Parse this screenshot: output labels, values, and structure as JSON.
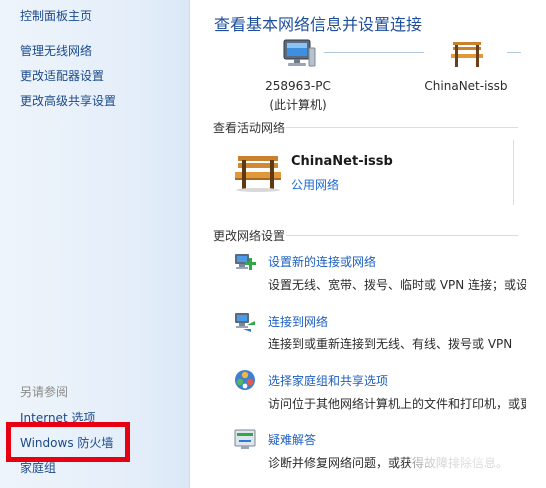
{
  "sidebar": {
    "home_link": "控制面板主页",
    "links": [
      "管理无线网络",
      "更改适配器设置",
      "更改高级共享设置"
    ],
    "see_also_header": "另请参阅",
    "see_also": [
      "Internet 选项",
      "Windows 防火墙",
      "家庭组"
    ],
    "highlight_color": "#e60012"
  },
  "main": {
    "title": "查看基本网络信息并设置连接",
    "map": {
      "computer_name": "258963-PC",
      "computer_sub": "(此计算机)",
      "network_name": "ChinaNet-issb"
    },
    "active_section": "查看活动网络",
    "active_network": {
      "name": "ChinaNet-issb",
      "type": "公用网络"
    },
    "change_section": "更改网络设置",
    "tasks": [
      {
        "link": "设置新的连接或网络",
        "desc": "设置无线、宽带、拨号、临时或 VPN 连接；或设"
      },
      {
        "link": "连接到网络",
        "desc": "连接到或重新连接到无线、有线、拨号或 VPN"
      },
      {
        "link": "选择家庭组和共享选项",
        "desc": "访问位于其他网络计算机上的文件和打印机，或更"
      },
      {
        "link": "疑难解答",
        "desc": "诊断并修复网络问题，或获得故障排除信息。"
      }
    ]
  },
  "colors": {
    "link": "#1d5fbf",
    "title": "#1e4f9c",
    "sidebar_link": "#1a4a8a"
  }
}
